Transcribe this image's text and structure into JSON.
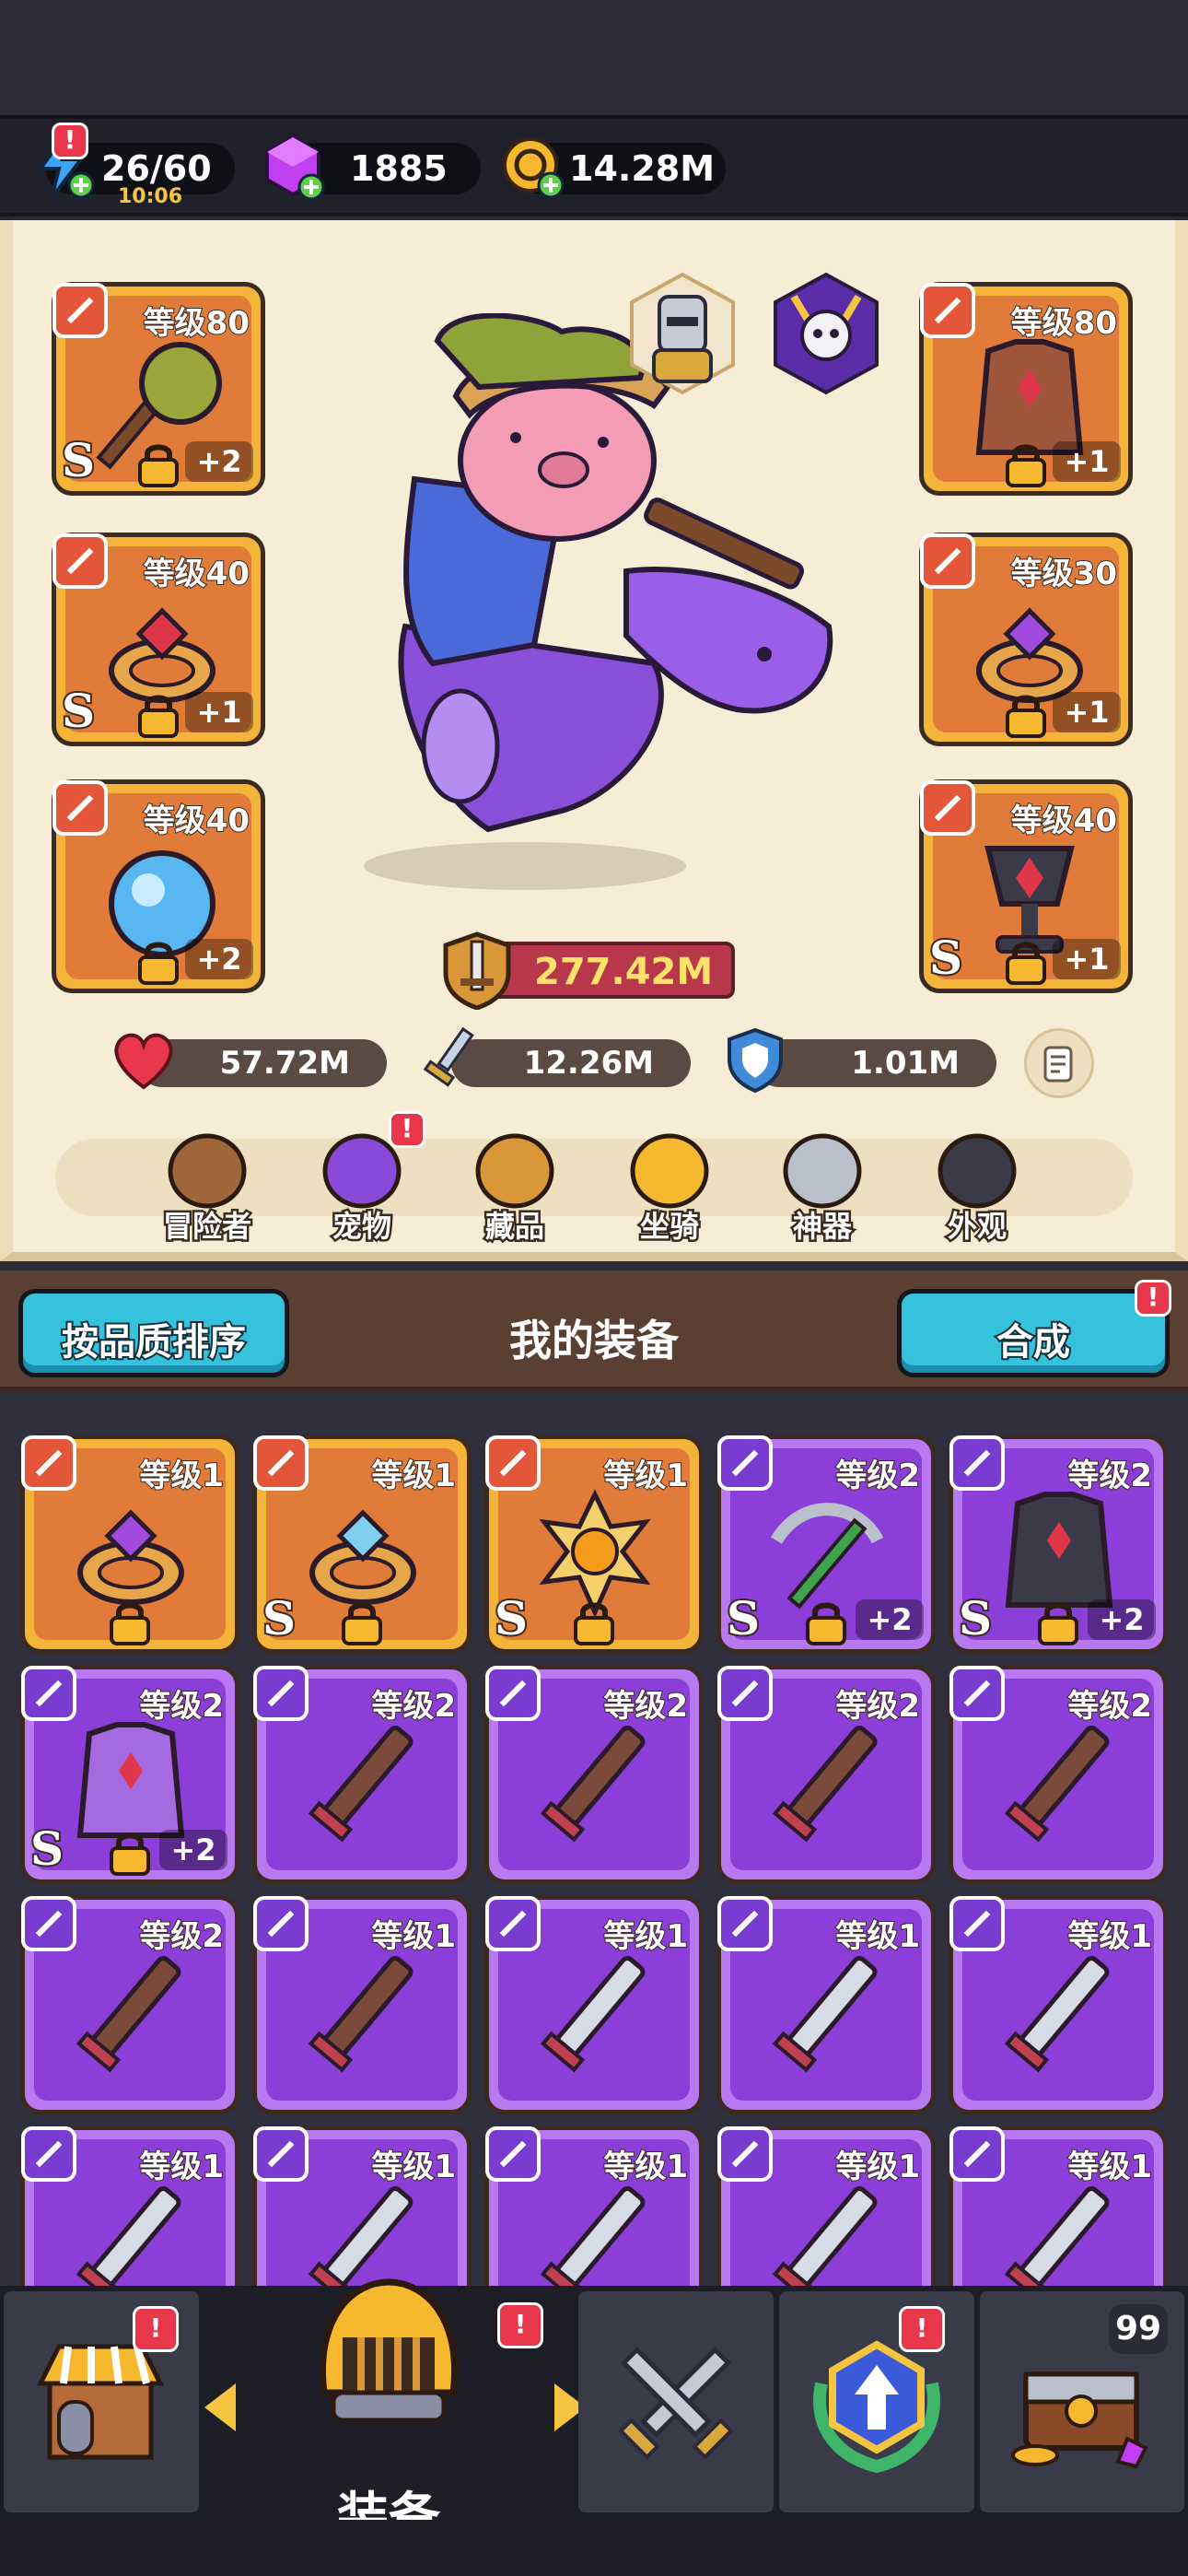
{
  "resources": {
    "energy": "26/60",
    "energy_timer": "10:06",
    "gems": "1885",
    "gold": "14.28M"
  },
  "hero": {
    "slots_left": [
      {
        "level": "等级80",
        "plus": "+2",
        "s": "S",
        "category": "weapon-icon",
        "item": "spiked-mace-icon"
      },
      {
        "level": "等级40",
        "plus": "+1",
        "s": "S",
        "category": "ring-icon",
        "item": "ruby-ring-icon"
      },
      {
        "level": "等级40",
        "plus": "+2",
        "s": "",
        "category": "necklace-icon",
        "item": "water-orb-icon"
      }
    ],
    "slots_right": [
      {
        "level": "等级80",
        "plus": "+1",
        "s": "",
        "category": "armor-icon",
        "item": "leather-armor-icon"
      },
      {
        "level": "等级30",
        "plus": "+1",
        "s": "",
        "category": "ring-icon",
        "item": "amethyst-ring-icon"
      },
      {
        "level": "等级40",
        "plus": "+1",
        "s": "S",
        "category": "necklace-icon",
        "item": "chalice-icon"
      }
    ],
    "power": "277.42M",
    "stats": {
      "hp": "57.72M",
      "attack": "12.26M",
      "defense": "1.01M"
    }
  },
  "tabs": [
    "冒险者",
    "宠物",
    "藏品",
    "坐骑",
    "神器",
    "外观"
  ],
  "inventory": {
    "sort_label": "按品质排序",
    "title": "我的装备",
    "merge_label": "合成",
    "rows": [
      [
        {
          "level": "等级1",
          "rarity": "orange",
          "cat": "ring-icon",
          "item": "amethyst-ring-icon",
          "s": "",
          "plus": "",
          "lock": true
        },
        {
          "level": "等级1",
          "rarity": "orange",
          "cat": "ring-icon",
          "item": "crystal-ring-icon",
          "s": "S",
          "plus": "",
          "lock": true
        },
        {
          "level": "等级1",
          "rarity": "orange",
          "cat": "necklace-icon",
          "item": "sun-amulet-icon",
          "s": "S",
          "plus": "",
          "lock": true
        },
        {
          "level": "等级2",
          "rarity": "purple",
          "cat": "weapon-icon",
          "item": "crossbow-icon",
          "s": "S",
          "plus": "+2",
          "lock": true
        },
        {
          "level": "等级2",
          "rarity": "purple",
          "cat": "armor-icon",
          "item": "dark-armor-icon",
          "s": "S",
          "plus": "+2",
          "lock": true
        }
      ],
      [
        {
          "level": "等级2",
          "rarity": "purple",
          "cat": "armor-icon",
          "item": "cloak-icon",
          "s": "S",
          "plus": "+2",
          "lock": true
        },
        {
          "level": "等级2",
          "rarity": "purple",
          "cat": "weapon-icon",
          "item": "wooden-sword-icon",
          "s": "",
          "plus": "",
          "lock": false
        },
        {
          "level": "等级2",
          "rarity": "purple",
          "cat": "weapon-icon",
          "item": "wooden-sword-icon",
          "s": "",
          "plus": "",
          "lock": false
        },
        {
          "level": "等级2",
          "rarity": "purple",
          "cat": "weapon-icon",
          "item": "wooden-sword-icon",
          "s": "",
          "plus": "",
          "lock": false
        },
        {
          "level": "等级2",
          "rarity": "purple",
          "cat": "weapon-icon",
          "item": "wooden-sword-icon",
          "s": "",
          "plus": "",
          "lock": false
        }
      ],
      [
        {
          "level": "等级2",
          "rarity": "purple",
          "cat": "weapon-icon",
          "item": "wooden-sword-icon",
          "s": "",
          "plus": "",
          "lock": false
        },
        {
          "level": "等级1",
          "rarity": "purple",
          "cat": "weapon-icon",
          "item": "wooden-sword-icon",
          "s": "",
          "plus": "",
          "lock": false
        },
        {
          "level": "等级1",
          "rarity": "purple",
          "cat": "weapon-icon",
          "item": "steel-sword-icon",
          "s": "",
          "plus": "",
          "lock": false
        },
        {
          "level": "等级1",
          "rarity": "purple",
          "cat": "weapon-icon",
          "item": "steel-sword-icon",
          "s": "",
          "plus": "",
          "lock": false
        },
        {
          "level": "等级1",
          "rarity": "purple",
          "cat": "weapon-icon",
          "item": "steel-sword-icon",
          "s": "",
          "plus": "",
          "lock": false
        }
      ],
      [
        {
          "level": "等级1",
          "rarity": "purple",
          "cat": "weapon-icon",
          "item": "steel-sword-icon",
          "s": "",
          "plus": "",
          "lock": false
        },
        {
          "level": "等级1",
          "rarity": "purple",
          "cat": "weapon-icon",
          "item": "steel-sword-icon",
          "s": "",
          "plus": "",
          "lock": false
        },
        {
          "level": "等级1",
          "rarity": "purple",
          "cat": "weapon-icon",
          "item": "steel-sword-icon",
          "s": "",
          "plus": "",
          "lock": false
        },
        {
          "level": "等级1",
          "rarity": "purple",
          "cat": "weapon-icon",
          "item": "scimitar-icon",
          "s": "",
          "plus": "",
          "lock": false
        },
        {
          "level": "等级1",
          "rarity": "purple",
          "cat": "weapon-icon",
          "item": "scimitar-icon",
          "s": "",
          "plus": "",
          "lock": false
        }
      ]
    ]
  },
  "nav": {
    "active_label": "装备",
    "chest_count": "99"
  },
  "colors": {
    "orange_slot": "#f4b43a",
    "purple_slot": "#8b3fd8",
    "accent_cyan": "#35c2dc",
    "alert_red": "#e8364a"
  }
}
